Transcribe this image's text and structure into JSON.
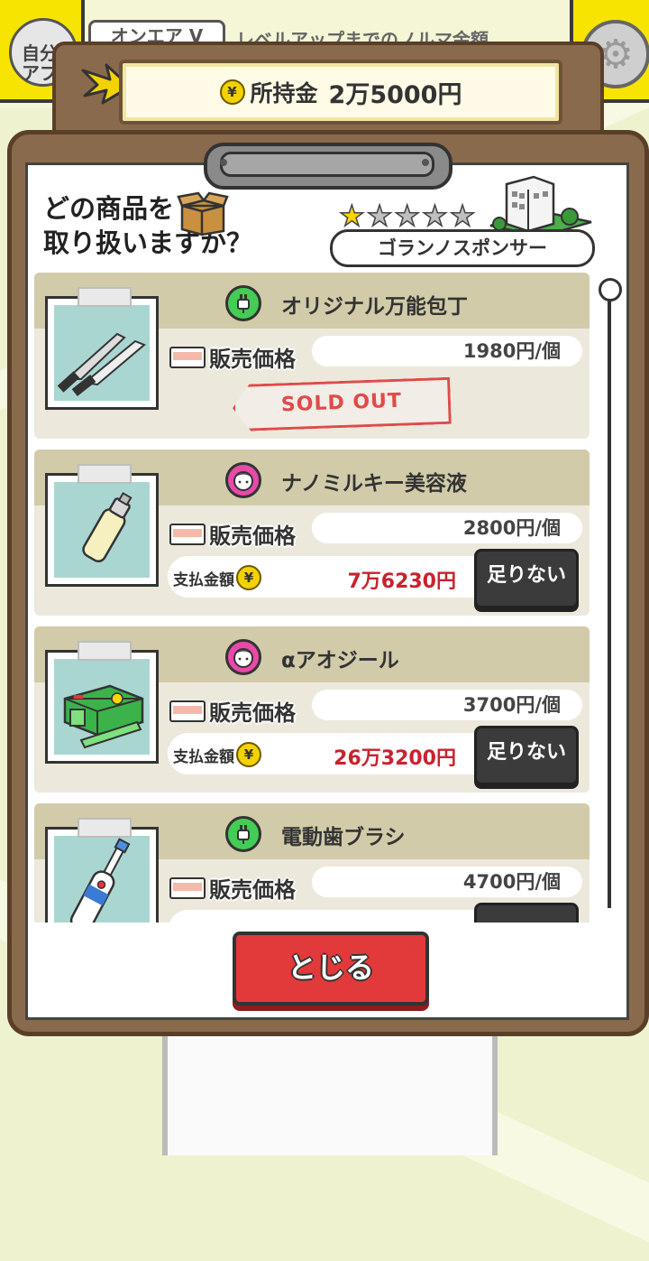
{
  "background": {
    "left_badge_text": "自分アプ",
    "top_tab_label": "オンエア V",
    "levelup_text": "レベルアップまでのノルマ金額"
  },
  "money": {
    "label": "所持金",
    "value": "2万5000円",
    "coin_symbol": "¥"
  },
  "header": {
    "title_line1": "どの商品を",
    "title_line2": "取り扱いますか？",
    "stars_filled": 1,
    "stars_total": 5,
    "sponsor": "ゴランノスポンサー"
  },
  "products": [
    {
      "name": "オリジナル万能包丁",
      "category_icon": "plug-icon",
      "price_label": "販売価格",
      "price": "1980円/個",
      "status": "SOLD OUT",
      "image": "kitchen-knife"
    },
    {
      "name": "ナノミルキー美容液",
      "category_icon": "face-icon",
      "price_label": "販売価格",
      "price": "2800円/個",
      "pay_label": "支払金額",
      "pay_value": "7万6230円",
      "button": "足りない",
      "image": "serum-bottle"
    },
    {
      "name": "αアオジール",
      "category_icon": "face-icon",
      "price_label": "販売価格",
      "price": "3700円/個",
      "pay_label": "支払金額",
      "pay_value": "26万3200円",
      "button": "足りない",
      "image": "aojiru-box"
    },
    {
      "name": "電動歯ブラシ",
      "category_icon": "plug-icon",
      "price_label": "販売価格",
      "price": "4700円/個",
      "image": "electric-toothbrush"
    }
  ],
  "close_button": "とじる",
  "colors": {
    "board": "#8a6a4c",
    "pay_red": "#c8232e",
    "close_red": "#e23a3a",
    "star_gold": "#ffd500"
  }
}
